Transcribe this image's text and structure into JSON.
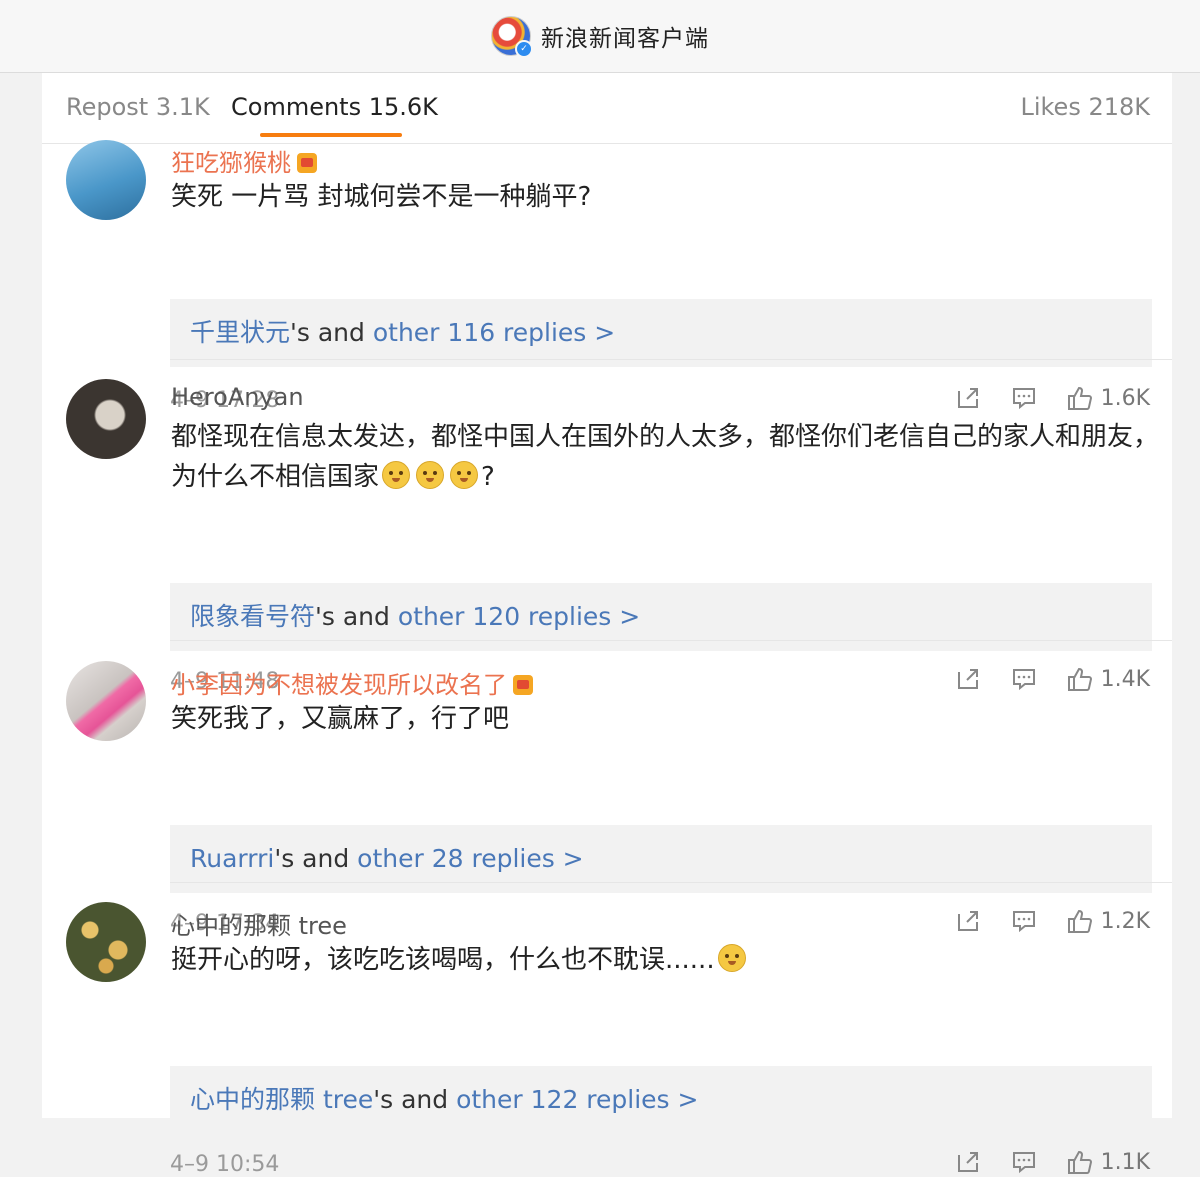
{
  "app": {
    "title": "新浪新闻客户端"
  },
  "tabs": {
    "repost": "Repost 3.1K",
    "comments": "Comments 15.6K",
    "likes": "Likes 218K"
  },
  "colors": {
    "accent": "#f77d0f",
    "vip_name": "#eb7350",
    "link": "#4a78b8"
  },
  "comments": [
    {
      "username": "狂吃猕猴桃",
      "text": "笑死 一片骂 封城何尝不是一种躺平?",
      "reply_user": "千里状元",
      "reply_mid": "'s and ",
      "reply_more": "other 116 replies >",
      "time": "4–9 17:28",
      "likes": "1.6K"
    },
    {
      "username": "HeroAnyan",
      "text": "都怪现在信息太发达，都怪中国人在国外的人太多，都怪你们老信自己的家人和朋友，为什么不相信国家",
      "text_end": "?",
      "reply_user": "限象看号符",
      "reply_mid": "'s and ",
      "reply_more": "other 120 replies >",
      "time": "4–9 11:48",
      "likes": "1.4K"
    },
    {
      "username": "小李因为不想被发现所以改名了",
      "text": "笑死我了，又赢麻了，行了吧",
      "reply_user": "Ruarrri",
      "reply_mid": "'s and ",
      "reply_more": "other 28 replies >",
      "time": "4–9 17:34",
      "likes": "1.2K"
    },
    {
      "username": "心中的那颗 tree",
      "text": "挺开心的呀，该吃吃该喝喝，什么也不耽误......",
      "reply_user": "心中的那颗 tree",
      "reply_mid": "'s and ",
      "reply_more": "other 122 replies >",
      "time": "4–9 10:54",
      "likes": "1.1K"
    }
  ],
  "icons": [
    "share-icon",
    "comment-icon",
    "thumbs-up-icon",
    "crown-badge-icon",
    "verified-icon"
  ]
}
